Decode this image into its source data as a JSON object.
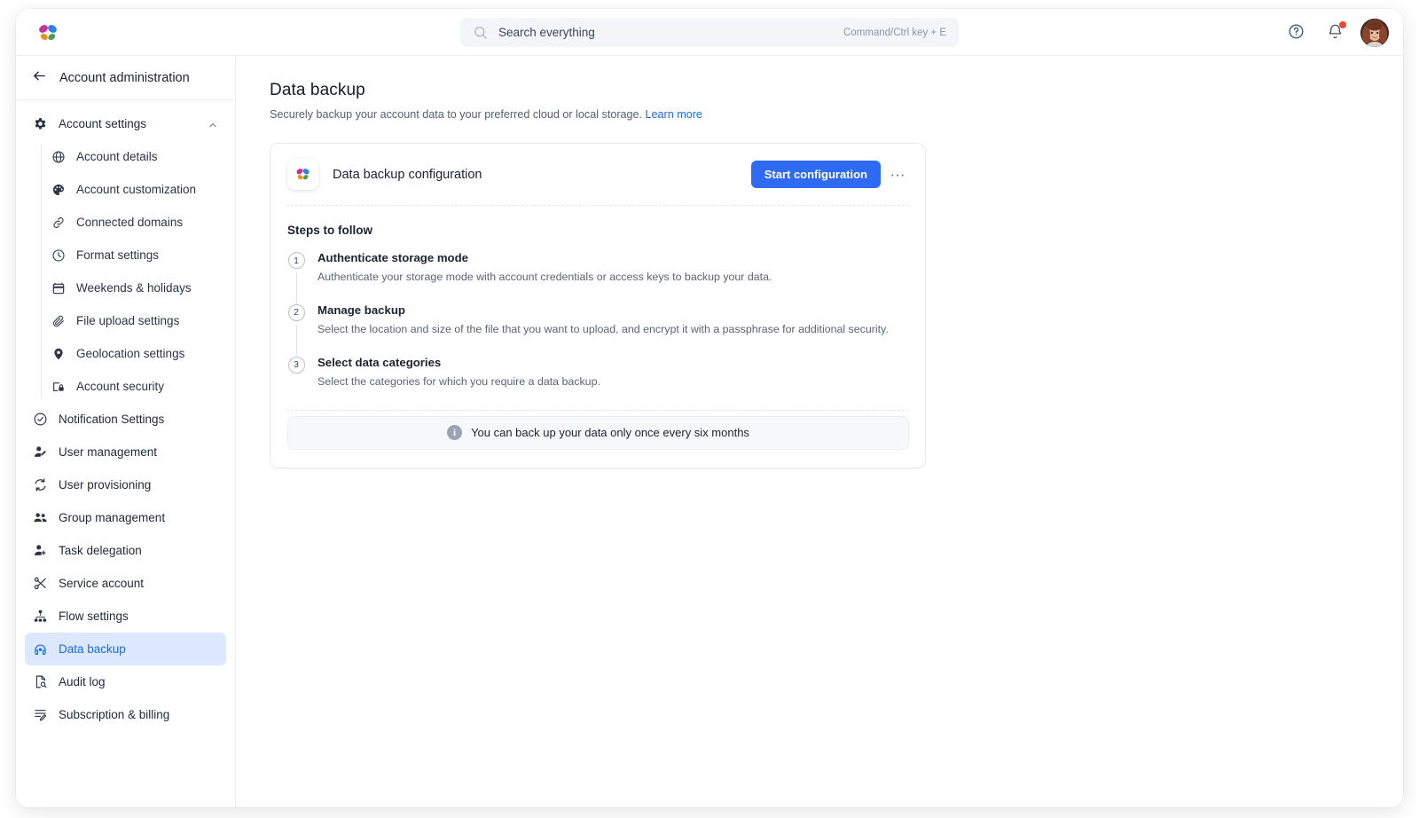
{
  "topbar": {
    "logo_name": "butterfly-logo",
    "search": {
      "placeholder": "Search everything",
      "value": "",
      "shortcut_hint": "Command/Ctrl key + E"
    },
    "help_label": "?",
    "notification_badge": true
  },
  "sidebar": {
    "header": "Account administration",
    "group": {
      "label": "Account settings",
      "expanded": true,
      "items": [
        {
          "label": "Account details",
          "icon": "globe-icon"
        },
        {
          "label": "Account customization",
          "icon": "palette-icon"
        },
        {
          "label": "Connected domains",
          "icon": "link-icon"
        },
        {
          "label": "Format settings",
          "icon": "clock-icon"
        },
        {
          "label": "Weekends & holidays",
          "icon": "calendar-icon"
        },
        {
          "label": "File upload settings",
          "icon": "paperclip-icon"
        },
        {
          "label": "Geolocation settings",
          "icon": "pin-icon"
        },
        {
          "label": "Account security",
          "icon": "shield-lock-icon"
        }
      ]
    },
    "items": [
      {
        "label": "Notification Settings",
        "icon": "bell-check-icon",
        "active": false
      },
      {
        "label": "User management",
        "icon": "user-edit-icon",
        "active": false
      },
      {
        "label": "User provisioning",
        "icon": "sync-icon",
        "active": false
      },
      {
        "label": "Group management",
        "icon": "users-icon",
        "active": false
      },
      {
        "label": "Task delegation",
        "icon": "user-plus-icon",
        "active": false
      },
      {
        "label": "Service account",
        "icon": "scissors-icon",
        "active": false
      },
      {
        "label": "Flow settings",
        "icon": "hierarchy-icon",
        "active": false
      },
      {
        "label": "Data backup",
        "icon": "data-backup-icon",
        "active": true
      },
      {
        "label": "Audit log",
        "icon": "audit-icon",
        "active": false
      },
      {
        "label": "Subscription & billing",
        "icon": "receipt-icon",
        "active": false
      }
    ]
  },
  "main": {
    "title": "Data backup",
    "subtitle": "Securely backup your account data to your preferred cloud or local storage.",
    "learn_more": "Learn more",
    "card": {
      "title": "Data backup configuration",
      "primary_button": "Start configuration",
      "more_button": "···",
      "steps_title": "Steps to follow",
      "steps": [
        {
          "number": "1",
          "name": "Authenticate storage mode",
          "description": "Authenticate your storage mode with account credentials or access keys to backup your data."
        },
        {
          "number": "2",
          "name": "Manage backup",
          "description": "Select the location and size of the file that you want to upload, and encrypt it with a passphrase for additional security."
        },
        {
          "number": "3",
          "name": "Select data categories",
          "description": "Select the categories for which you require a data backup."
        }
      ],
      "info_note": "You can back up your data only once every six months"
    }
  },
  "colors": {
    "accent_blue": "#2f6bf2",
    "link_blue": "#1d6ae5",
    "active_nav_bg": "#dce8fd",
    "notification_red": "#f8432f",
    "border": "#e7eaf0"
  }
}
